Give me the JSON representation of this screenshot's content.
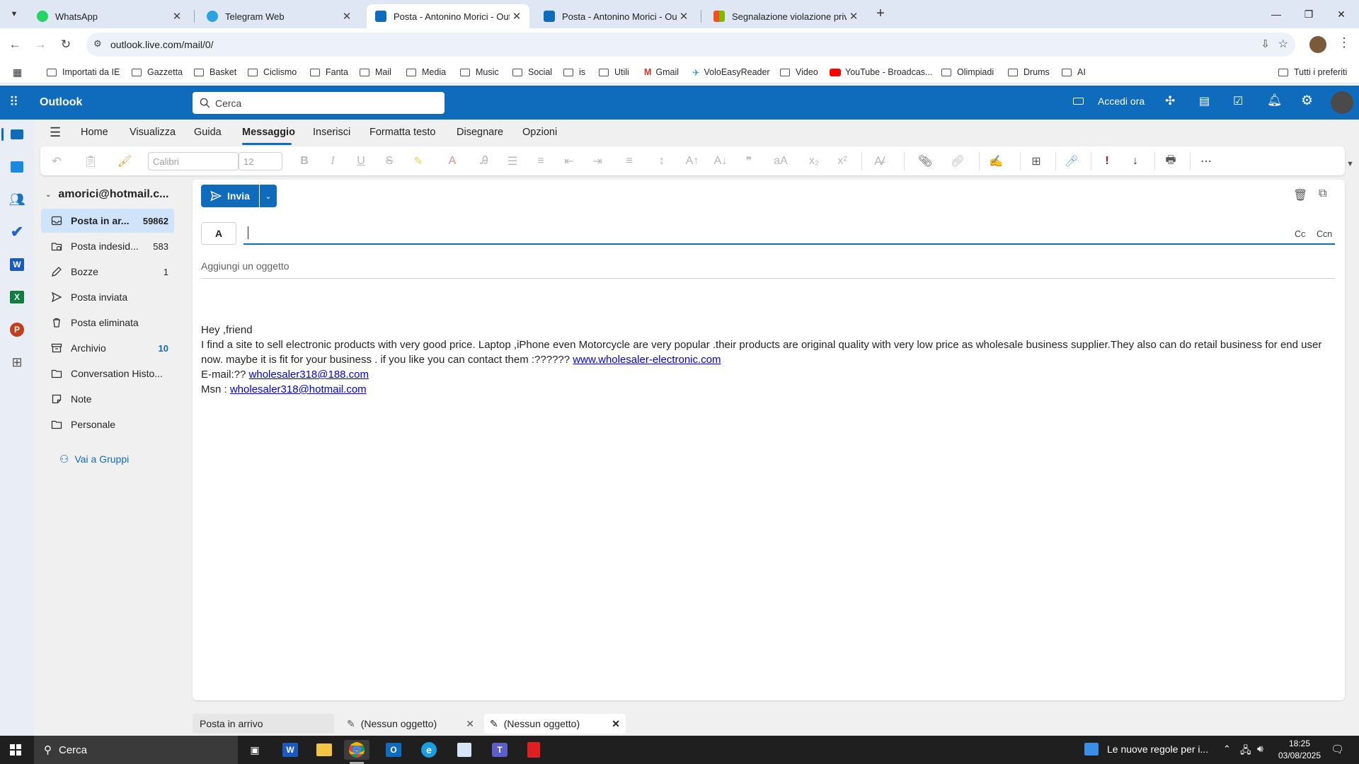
{
  "browser": {
    "tabs": [
      {
        "title": "WhatsApp",
        "active": false
      },
      {
        "title": "Telegram Web",
        "active": false
      },
      {
        "title": "Posta - Antonino Morici - Outlo",
        "active": true
      },
      {
        "title": "Posta - Antonino Morici - Outlo",
        "active": false
      },
      {
        "title": "Segnalazione violazione privacy",
        "active": false
      }
    ],
    "new_tab": "+",
    "url": "outlook.live.com/mail/0/",
    "bookmarks": [
      "Importati da IE",
      "Gazzetta",
      "Basket",
      "Ciclismo",
      "Fanta",
      "Mail",
      "Media",
      "Music",
      "Social",
      "is",
      "Utili",
      "Gmail",
      "VoloEasyReader",
      "Video",
      "YouTube - Broadcas...",
      "Olimpiadi",
      "Drums",
      "AI"
    ],
    "all_bookmarks": "Tutti i preferiti"
  },
  "outlook": {
    "app_name": "Outlook",
    "search_placeholder": "Cerca",
    "meet_now": "Accedi ora",
    "ribbon_tabs": [
      "Home",
      "Visualizza",
      "Guida",
      "Messaggio",
      "Inserisci",
      "Formatta testo",
      "Disegnare",
      "Opzioni"
    ],
    "selected_ribbon_tab": "Messaggio",
    "font_name": "Calibri",
    "font_size": "12",
    "account": "amorici@hotmail.c...",
    "folders": [
      {
        "name": "Posta in ar...",
        "count": "59862",
        "selected": true
      },
      {
        "name": "Posta indesid...",
        "count": "583"
      },
      {
        "name": "Bozze",
        "count": "1"
      },
      {
        "name": "Posta inviata",
        "count": ""
      },
      {
        "name": "Posta eliminata",
        "count": ""
      },
      {
        "name": "Archivio",
        "count": "10"
      },
      {
        "name": "Conversation Histo...",
        "count": ""
      },
      {
        "name": "Note",
        "count": ""
      },
      {
        "name": "Personale",
        "count": ""
      }
    ],
    "groups_link": "Vai a Gruppi",
    "compose": {
      "send_label": "Invia",
      "to_label": "A",
      "cc": "Cc",
      "bcc": "Ccn",
      "subject_placeholder": "Aggiungi un oggetto",
      "body_greeting": "Hey ,friend",
      "body_text": "I find a site to sell electronic products with very good price. Laptop ,iPhone even Motorcycle are very popular .their products are original quality with very low price as wholesale business supplier.They also can do retail business for end user now. maybe it is fit for your business . if you like you can contact them :?????? ",
      "body_link": "www.wholesaler-electronic.com",
      "email_prefix": "E-mail:?? ",
      "email_link": "wholesaler318@188.com",
      "msn_prefix": "Msn : ",
      "msn_link": "wholesaler318@hotmail.com"
    },
    "bottom_tabs": [
      "Posta in arrivo",
      "(Nessun oggetto)",
      "(Nessun oggetto)"
    ]
  },
  "taskbar": {
    "search": "Cerca",
    "news": "Le nuove regole per i...",
    "time": "18:25",
    "date": "03/08/2025"
  },
  "colors": {
    "brand": "#0f6cbd",
    "link": "#0000ee",
    "selected_folder": "#cfe4fa"
  }
}
